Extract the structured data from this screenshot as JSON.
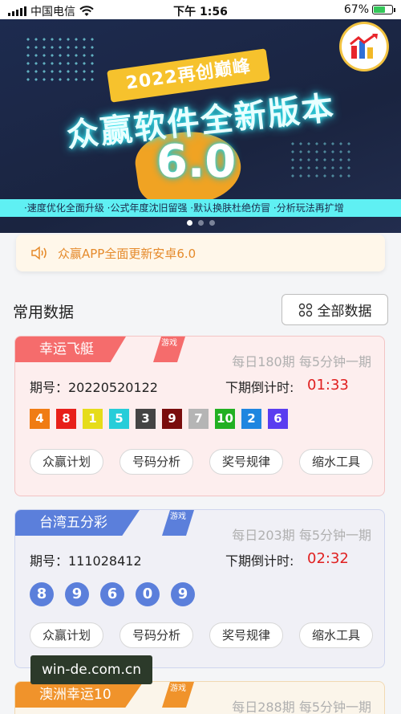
{
  "status_bar": {
    "carrier": "中国电信",
    "time": "下午 1:56",
    "battery": "67%",
    "battery_level": 0.67
  },
  "banner": {
    "ribbon": "2022再创巅峰",
    "headline": "众赢软件全新版本",
    "version": "6.0",
    "tagline": "·速度优化全面升级  ·公式年度沈旧留强  ·默认换肤杜绝仿冒  ·分析玩法再扩增",
    "page_count": 3,
    "active_page": 1
  },
  "notice": {
    "text": "众赢APP全面更新安卓6.0"
  },
  "section": {
    "title": "常用数据",
    "all_button": "全部数据"
  },
  "cards": [
    {
      "name": "幸运飞艇",
      "game_tag": "游戏",
      "period": "每日180期 每5分钟一期",
      "issue": "期号：20220520122",
      "countdown_label": "下期倒计时:",
      "countdown": "01:33",
      "numbers": [
        "4",
        "8",
        "1",
        "5",
        "3",
        "9",
        "7",
        "10",
        "2",
        "6"
      ],
      "actions": [
        "众赢计划",
        "号码分析",
        "奖号规律",
        "缩水工具"
      ]
    },
    {
      "name": "台湾五分彩",
      "game_tag": "游戏",
      "period": "每日203期 每5分钟一期",
      "issue": "期号：111028412",
      "countdown_label": "下期倒计时:",
      "countdown": "02:32",
      "numbers": [
        "8",
        "9",
        "6",
        "0",
        "9"
      ],
      "actions": [
        "众赢计划",
        "号码分析",
        "奖号规律",
        "缩水工具"
      ]
    },
    {
      "name": "澳洲幸运10",
      "game_tag": "游戏",
      "period": "每日288期 每5分钟一期"
    }
  ],
  "colors": {
    "card1_tag": "#f56c6c",
    "card2_tag": "#5b7fdb",
    "card3_tag": "#f0932b",
    "countdown": "#e02020",
    "notice_text": "#e58a2b",
    "ball_colors": [
      "#f07c14",
      "#e8201a",
      "#e6dc1a",
      "#27cdd9",
      "#444444",
      "#7a0d0d",
      "#b5b5b5",
      "#22b022",
      "#1f86e0",
      "#5a3df0"
    ]
  },
  "watermark": "win-de.com.cn"
}
